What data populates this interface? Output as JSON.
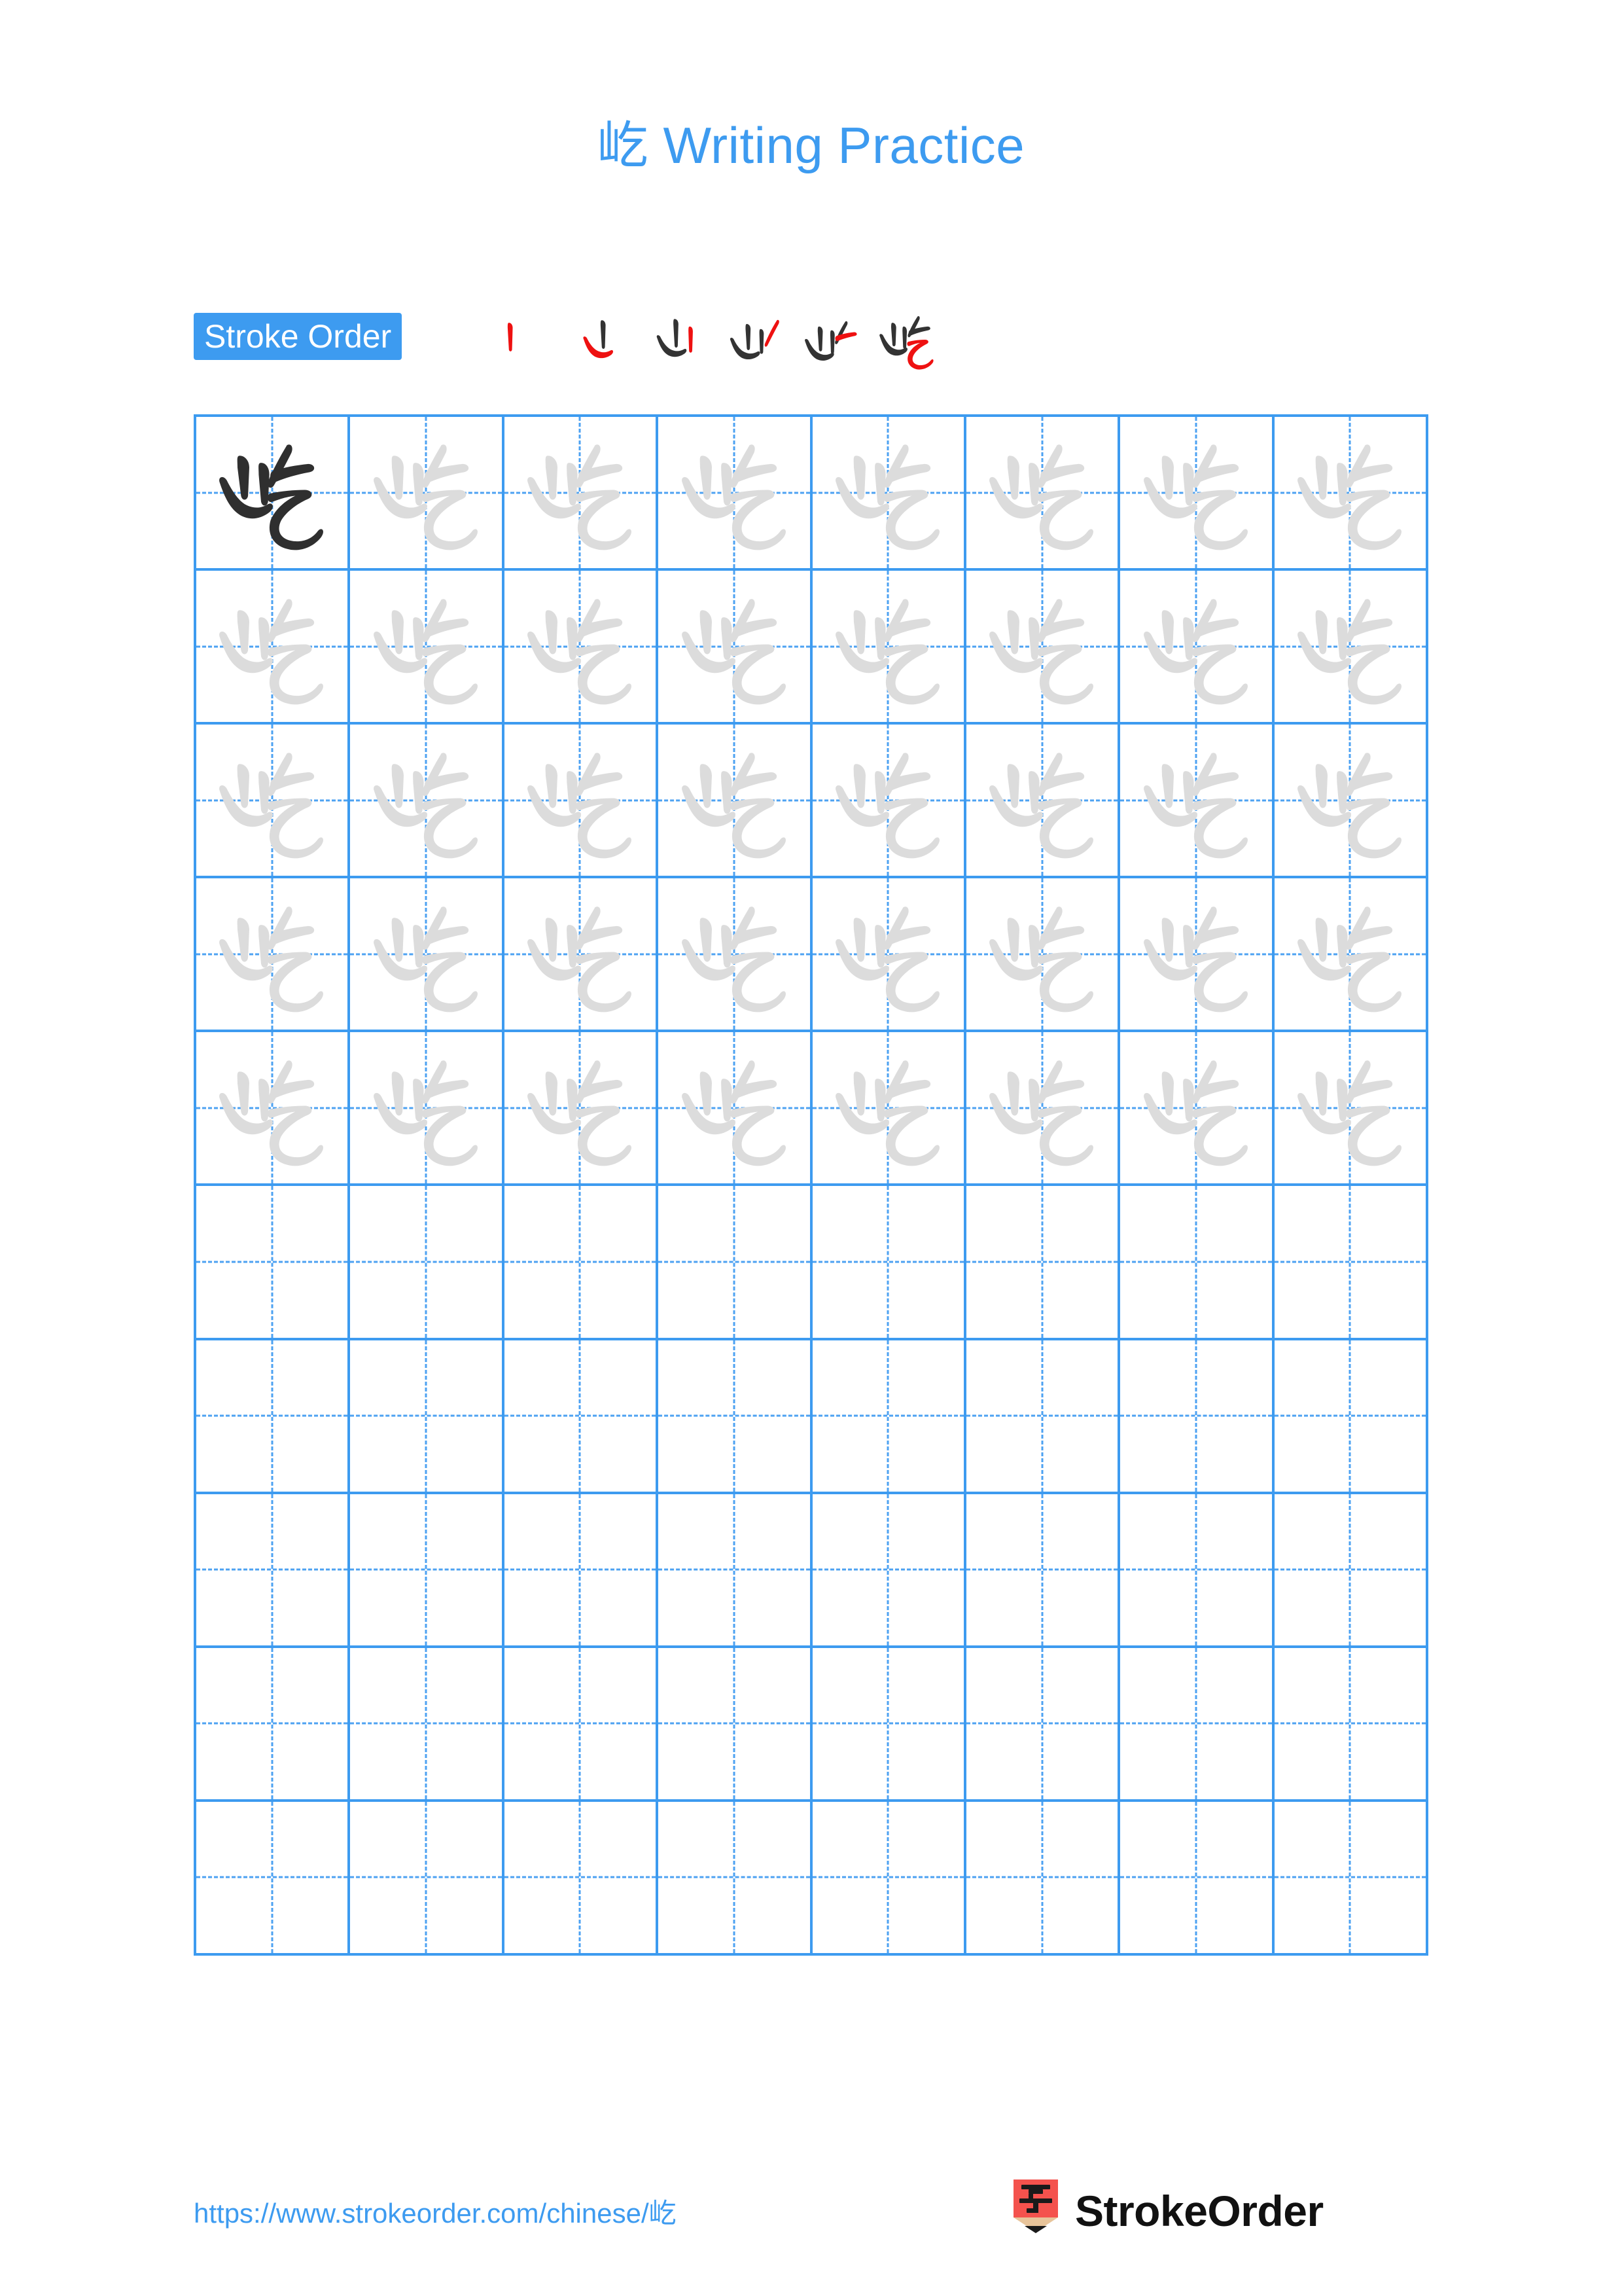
{
  "page": {
    "character": "屹",
    "title": "屹 Writing Practice",
    "background_color": "#ffffff",
    "accent_color": "#3d9bf0",
    "stroke_highlight_color": "#ee1111",
    "traced_char_color": "#dcdcdc",
    "model_char_color": "#2f2f2f"
  },
  "stroke_order": {
    "badge_label": "Stroke Order",
    "total_strokes": 6,
    "steps": [
      {
        "index": 1,
        "name": "stroke-step-1",
        "new_stroke": "丨 shu (vertical)"
      },
      {
        "index": 2,
        "name": "stroke-step-2",
        "new_stroke": "丨 shu-ti (vertical rising)"
      },
      {
        "index": 3,
        "name": "stroke-step-3",
        "new_stroke": "丨 shu (vertical)"
      },
      {
        "index": 4,
        "name": "stroke-step-4",
        "new_stroke": "丿 pie (left falling)"
      },
      {
        "index": 5,
        "name": "stroke-step-5",
        "new_stroke": "一 heng (horizontal)"
      },
      {
        "index": 6,
        "name": "stroke-step-6",
        "new_stroke": "乚 heng-zhe-wan-gou (hook)"
      }
    ]
  },
  "grid": {
    "columns": 8,
    "rows": 10,
    "filled_rows": 5,
    "empty_rows": 5,
    "model_cell": {
      "row": 1,
      "column": 1
    },
    "cell_guide": "dashed-cross"
  },
  "footer": {
    "url": "https://www.strokeorder.com/chinese/屹",
    "brand_name": "StrokeOrder",
    "logo_char": "字",
    "logo_body_color": "#f4524d",
    "logo_wood_color": "#e8c49a",
    "logo_tip_color": "#1a1a1a"
  }
}
